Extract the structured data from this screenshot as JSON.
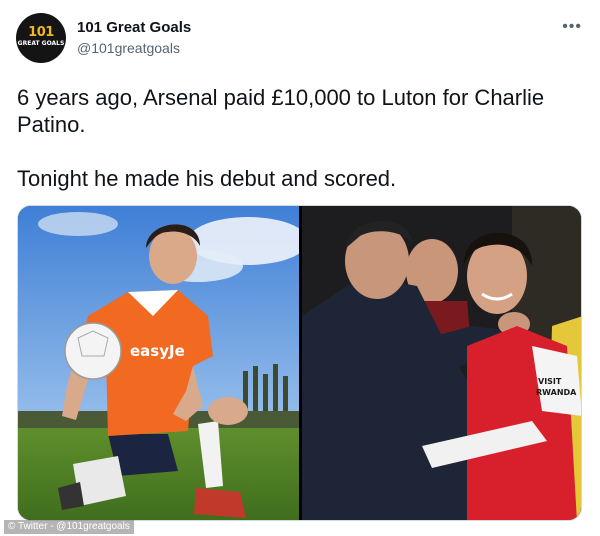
{
  "header": {
    "display_name": "101 Great Goals",
    "handle": "@101greatgoals",
    "avatar_logo": "101",
    "avatar_sub": "GREAT GOALS",
    "more_icon": "more-horizontal-icon"
  },
  "tweet": {
    "paragraphs": [
      "6 years ago, Arsenal paid £10,000 to Luton for Charlie Patino.",
      "Tonight he made his debut and scored."
    ]
  },
  "media": {
    "left_photo": {
      "shirt_text": "easyJet"
    },
    "right_photo": {
      "shirt_text": "VISIT RWANDA"
    }
  },
  "credit": "© Twitter - @101greatgoals",
  "colors": {
    "luton_orange": "#f26a21",
    "arsenal_red": "#d8202c",
    "handle_grey": "#536471"
  }
}
